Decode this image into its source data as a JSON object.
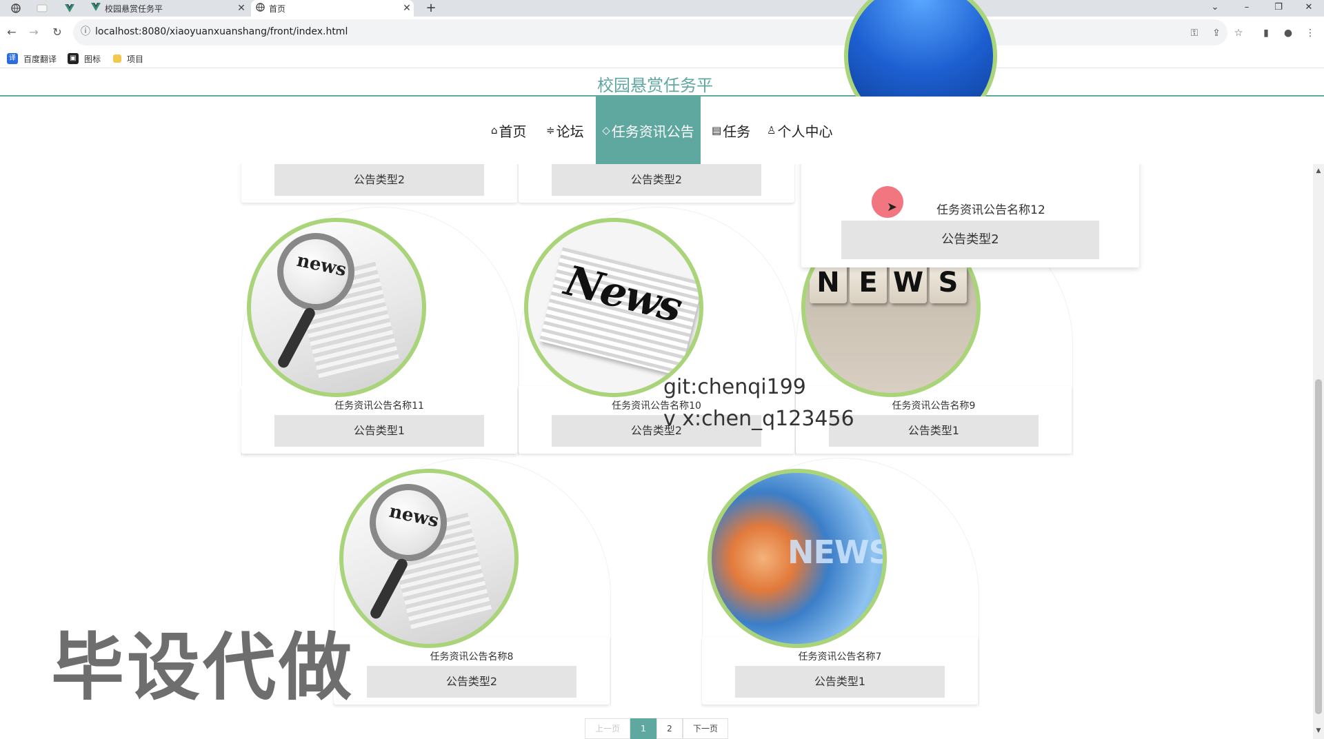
{
  "browser": {
    "tabs": [
      {
        "title": "校园悬赏任务平",
        "active": false
      },
      {
        "title": "首页",
        "active": true
      }
    ],
    "new_tab_label": "+",
    "url": "localhost:8080/xiaoyuanxuanshang/front/index.html",
    "bookmarks": [
      {
        "label": "百度翻译",
        "icon": "translate-icon",
        "color": "#2b6de0",
        "glyph": "译"
      },
      {
        "label": "图标",
        "icon": "image-icon",
        "color": "#222222",
        "glyph": "▣"
      },
      {
        "label": "项目",
        "icon": "folder-icon",
        "color": "#f2c94c",
        "glyph": ""
      }
    ]
  },
  "site": {
    "title": "校园悬赏任务平",
    "accent": "#5fa8a0",
    "nav": [
      {
        "label": "首页",
        "icon": "home-icon",
        "glyph": "⌂",
        "active": false
      },
      {
        "label": "论坛",
        "icon": "forum-icon",
        "glyph": "≑",
        "active": false
      },
      {
        "label": "任务资讯公告",
        "icon": "tag-icon",
        "glyph": "◇",
        "active": true
      },
      {
        "label": "任务",
        "icon": "task-icon",
        "glyph": "▤",
        "active": false
      },
      {
        "label": "个人中心",
        "icon": "user-icon",
        "glyph": "♙",
        "active": false
      }
    ]
  },
  "cards": {
    "top_partial": [
      {
        "type": "公告类型2"
      },
      {
        "type": "公告类型2"
      }
    ],
    "floating": {
      "name": "任务资讯公告名称12",
      "type": "公告类型2"
    },
    "row1": [
      {
        "name": "任务资讯公告名称11",
        "type": "公告类型1",
        "image": "magnifier-news"
      },
      {
        "name": "任务资讯公告名称10",
        "type": "公告类型2",
        "image": "newspaper-news"
      },
      {
        "name": "任务资讯公告名称9",
        "type": "公告类型1",
        "image": "cubes-news"
      }
    ],
    "row2": [
      {
        "name": "任务资讯公告名称8",
        "type": "公告类型2",
        "image": "magnifier-news"
      },
      {
        "name": "任务资讯公告名称7",
        "type": "公告类型1",
        "image": "globe-news"
      }
    ],
    "image_words": {
      "magnifier": "news",
      "newspaper": "News",
      "cubes": [
        "N",
        "E",
        "W",
        "S"
      ],
      "globe": "NEWS"
    }
  },
  "pagination": {
    "prev": "上一页",
    "pages": [
      "1",
      "2"
    ],
    "current": "1",
    "next": "下一页"
  },
  "overlays": {
    "git": "git:chenqi199",
    "vx": "v x:chen_q123456",
    "big_text": "毕设代做"
  }
}
